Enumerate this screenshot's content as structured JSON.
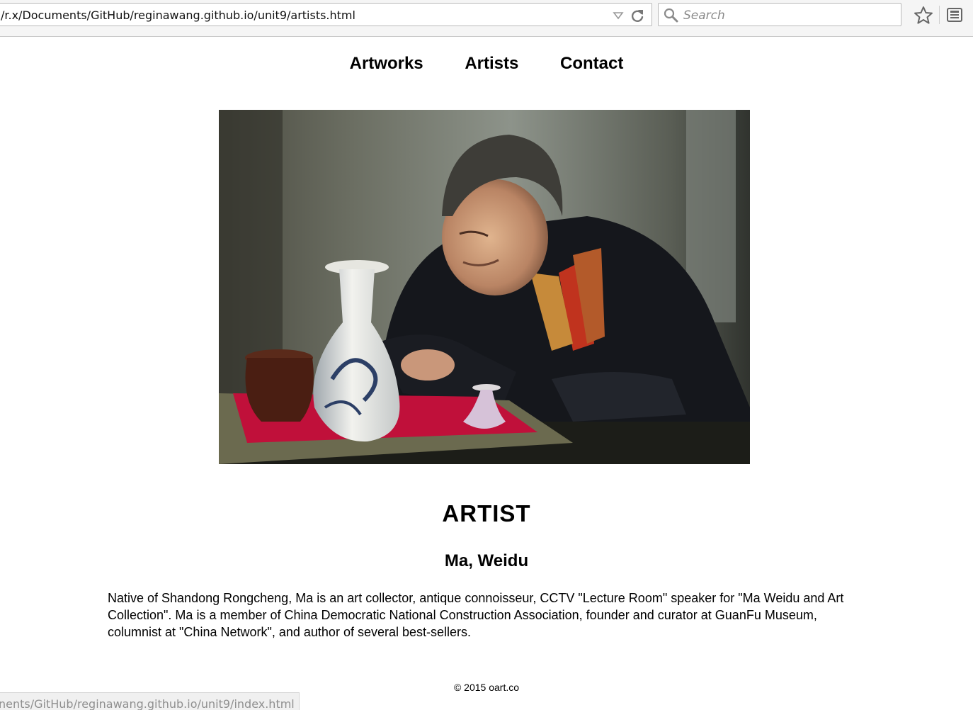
{
  "browser": {
    "url": "/r.x/Documents/GitHub/reginawang.github.io/unit9/artists.html",
    "search_placeholder": "Search",
    "status_url": "nents/GitHub/reginawang.github.io/unit9/index.html"
  },
  "nav": {
    "items": [
      {
        "label": "Artworks"
      },
      {
        "label": "Artists"
      },
      {
        "label": "Contact"
      }
    ]
  },
  "artist": {
    "heading": "ARTIST",
    "name": "Ma, Weidu",
    "bio": "Native of Shandong Rongcheng, Ma is an art collector, antique connoisseur, CCTV \"Lecture Room\" speaker for \"Ma Weidu and Art Collection\". Ma is a member of China Democratic National Construction Association, founder and curator at GuanFu Museum, columnist at \"China Network\", and author of several best-sellers."
  },
  "footer": {
    "copyright": "© 2015 oart.co"
  }
}
